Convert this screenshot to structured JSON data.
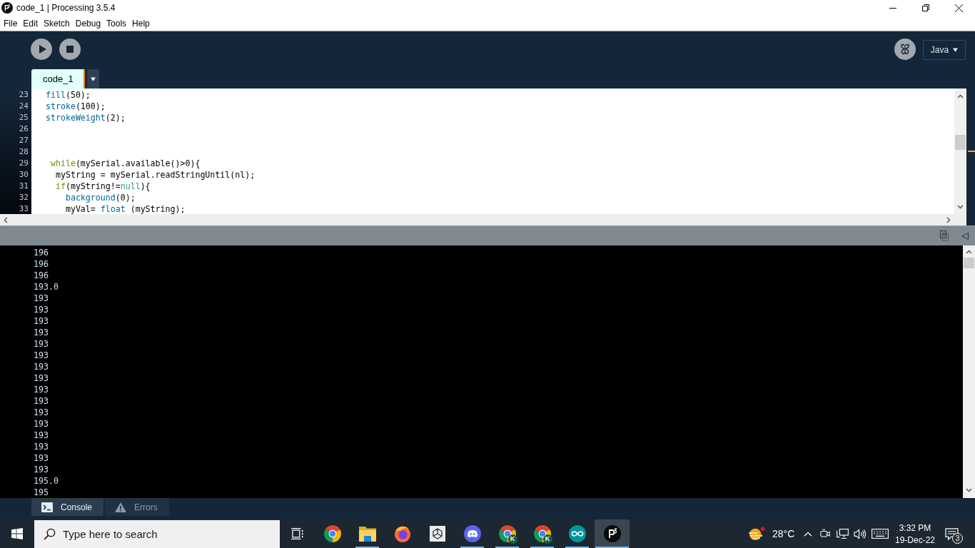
{
  "window": {
    "title": "code_1 | Processing 3.5.4"
  },
  "menu": [
    "File",
    "Edit",
    "Sketch",
    "Debug",
    "Tools",
    "Help"
  ],
  "toolbar": {
    "mode": "Java"
  },
  "tabs": [
    {
      "label": "code_1",
      "selected": true
    }
  ],
  "editor": {
    "lines": [
      {
        "number": "23",
        "segments": [
          {
            "text": "fill",
            "kind": "function"
          },
          {
            "text": "(50);",
            "kind": "plain"
          }
        ]
      },
      {
        "number": "24",
        "segments": [
          {
            "text": "stroke",
            "kind": "function"
          },
          {
            "text": "(100);",
            "kind": "plain"
          }
        ]
      },
      {
        "number": "25",
        "segments": [
          {
            "text": "strokeWeight",
            "kind": "function"
          },
          {
            "text": "(2);",
            "kind": "plain"
          }
        ]
      },
      {
        "number": "26"
      },
      {
        "number": "27"
      },
      {
        "number": "28"
      },
      {
        "number": "29",
        "segments": [
          {
            "text": " while",
            "kind": "keyword"
          },
          {
            "text": "(mySerial.available()>0){",
            "kind": "plain"
          }
        ]
      },
      {
        "number": "30",
        "segments": [
          {
            "text": "  myString = mySerial.readStringUntil(nl);",
            "kind": "plain"
          }
        ]
      },
      {
        "number": "31",
        "segments": [
          {
            "text": "  if",
            "kind": "keyword"
          },
          {
            "text": "(myString!=",
            "kind": "plain"
          },
          {
            "text": "null",
            "kind": "literal"
          },
          {
            "text": "){",
            "kind": "plain"
          }
        ]
      },
      {
        "number": "32",
        "segments": [
          {
            "text": "    background",
            "kind": "function"
          },
          {
            "text": "(0);",
            "kind": "plain"
          }
        ]
      },
      {
        "number": "33",
        "segments": [
          {
            "text": "    myVal= ",
            "kind": "plain"
          },
          {
            "text": "float",
            "kind": "function"
          },
          {
            "text": " (myString);",
            "kind": "plain"
          }
        ]
      }
    ]
  },
  "console": {
    "lines": [
      "196",
      "196",
      "196",
      "193.0",
      "193",
      "193",
      "193",
      "193",
      "193",
      "193",
      "193",
      "193",
      "193",
      "193",
      "193",
      "193",
      "193",
      "193",
      "193",
      "193",
      "195.0",
      "195"
    ]
  },
  "console_tabs": [
    {
      "label": "Console",
      "kind": "console",
      "selected": true
    },
    {
      "label": "Errors",
      "kind": "errors",
      "selected": false
    }
  ],
  "taskbar": {
    "search": {
      "placeholder": "Type here to search"
    },
    "apps": [
      {
        "kind": "chrome",
        "running": false,
        "selected": false
      },
      {
        "kind": "folder",
        "running": true,
        "selected": false
      },
      {
        "kind": "firefox",
        "running": false,
        "selected": false
      },
      {
        "kind": "unity",
        "running": false,
        "selected": false
      },
      {
        "kind": "discord",
        "running": true,
        "selected": false
      },
      {
        "kind": "chrome",
        "badge": "K",
        "running": true,
        "selected": false
      },
      {
        "kind": "chrome",
        "badge": "K",
        "running": true,
        "selected": false
      },
      {
        "kind": "arduino",
        "running": true,
        "selected": false
      },
      {
        "kind": "processing",
        "running": true,
        "selected": true
      }
    ],
    "weather": {
      "temperature": "28°C"
    },
    "clock": {
      "time": "3:32 PM",
      "date": "19-Dec-22"
    },
    "notifications": {
      "count": "3"
    }
  }
}
